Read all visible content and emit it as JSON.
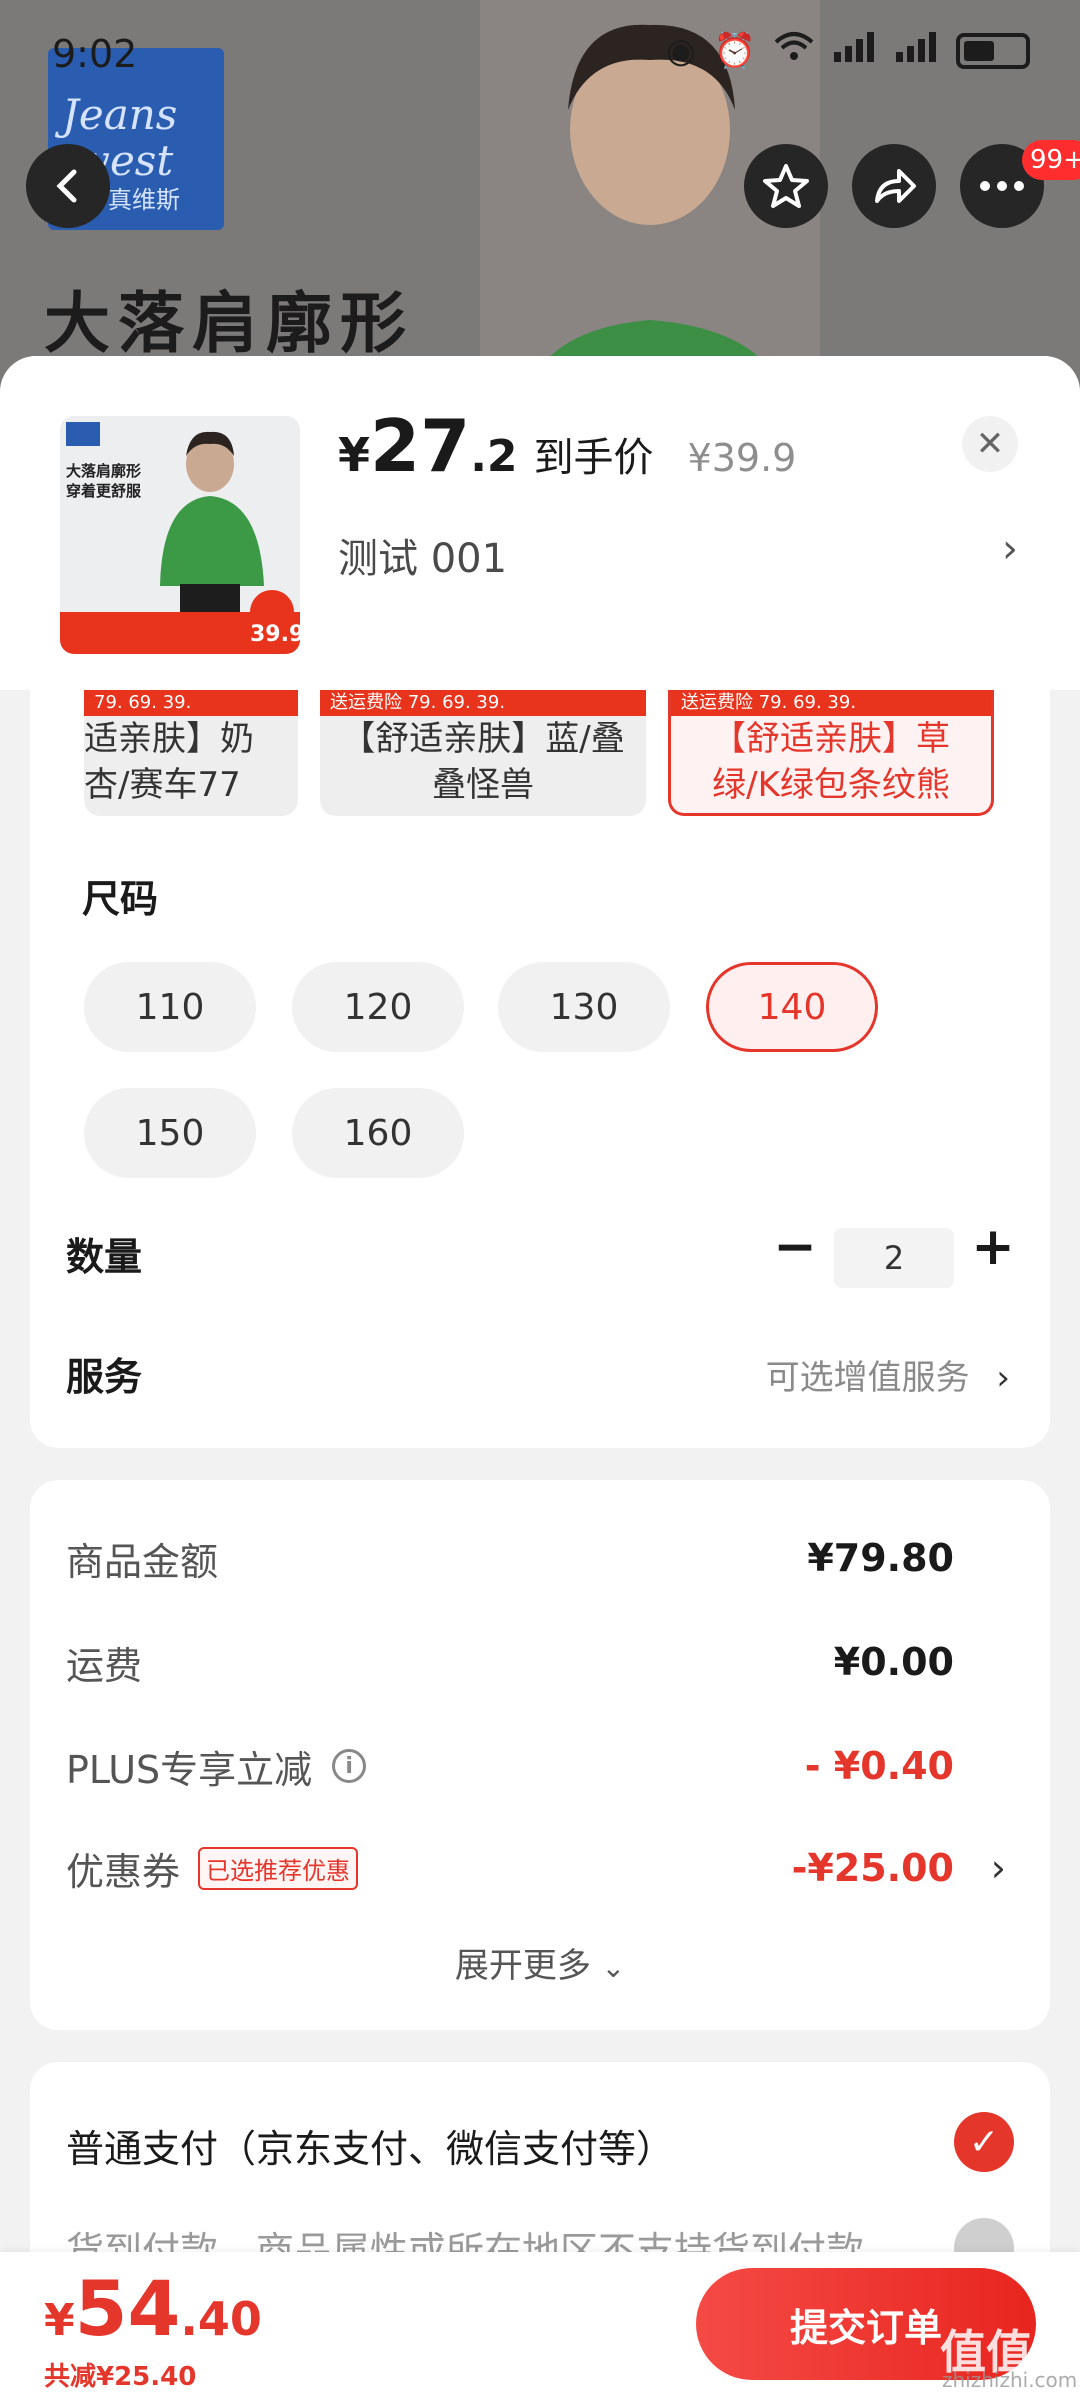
{
  "status_bar": {
    "time": "9:02",
    "badge_count": "99+"
  },
  "background": {
    "logo_line1": "Jeans",
    "logo_line2": "west",
    "logo_line3": "真维斯",
    "slogan": "大落肩廓形"
  },
  "product": {
    "thumb_text1": "大落肩廓形",
    "thumb_text2": "穿着更舒服",
    "thumb_price": "39.9",
    "price_currency": "¥",
    "price_int": "27",
    "price_dec": ".2",
    "price_label": "到手价",
    "original_price": "¥39.9",
    "variant": "测试 001"
  },
  "colors": [
    {
      "strip": "79. 69. 39.",
      "name": "适亲肤】奶杏/赛车77",
      "selected": false
    },
    {
      "strip": "送运费险 79. 69. 39.",
      "name": "【舒适亲肤】蓝/叠叠怪兽",
      "selected": false
    },
    {
      "strip": "送运费险 79. 69. 39.",
      "name": "【舒适亲肤】草绿/K绿包条纹熊",
      "selected": true
    }
  ],
  "sizes": {
    "label": "尺码",
    "options": [
      "110",
      "120",
      "130",
      "140",
      "150",
      "160"
    ],
    "selected": "140"
  },
  "quantity": {
    "label": "数量",
    "value": "2",
    "minus": "−",
    "plus": "+"
  },
  "service": {
    "label": "服务",
    "hint": "可选增值服务"
  },
  "summary": {
    "goods_label": "商品金额",
    "goods_value": "¥79.80",
    "shipping_label": "运费",
    "shipping_value": "¥0.00",
    "plus_label": "PLUS专享立减",
    "plus_value": "- ¥0.40",
    "coupon_label": "优惠券",
    "coupon_tag": "已选推荐优惠",
    "coupon_value": "-¥25.00",
    "expand_label": "展开更多"
  },
  "payment": {
    "option1": "普通支付（京东支付、微信支付等）",
    "option2": "货到付款，商品属性或所在地区不支持货到付款"
  },
  "bottom_bar": {
    "currency": "¥",
    "total_int": "54",
    "total_dec": ".40",
    "saved": "共减¥25.40",
    "submit_label": "提交订单",
    "watermark": "值值值",
    "watermark_url": "zhizhizhi.com"
  },
  "colors_theme": {
    "accent": "#e5362b",
    "background": "#f2f2f2"
  }
}
